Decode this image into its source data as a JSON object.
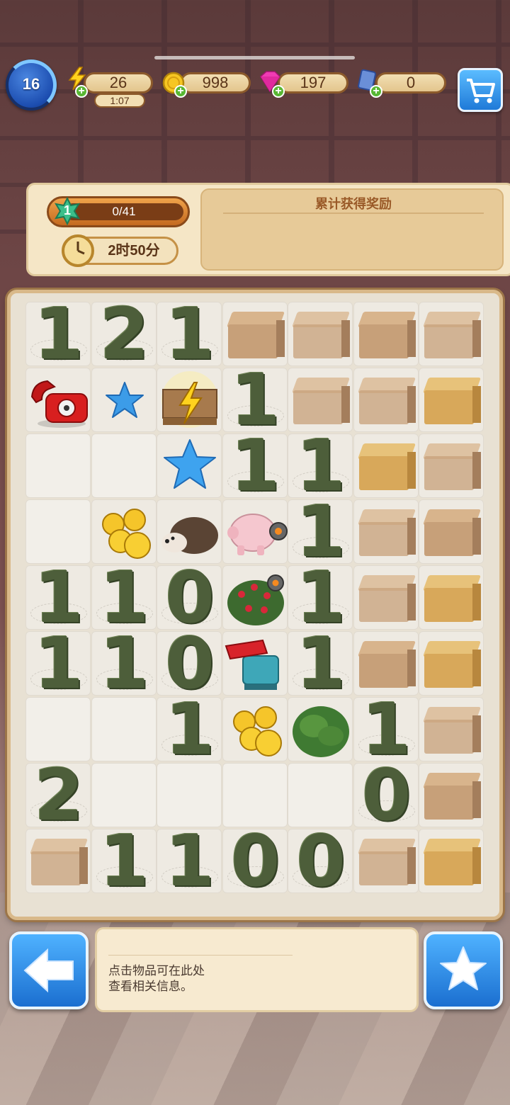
{
  "status_bar": {
    "level": "16",
    "energy": {
      "value": "26",
      "timer": "1:07",
      "icon": "lightning-icon"
    },
    "coins": {
      "value": "998",
      "icon": "coin-icon"
    },
    "gems": {
      "value": "197",
      "icon": "gem-icon"
    },
    "tickets": {
      "value": "0",
      "icon": "ticket-icon"
    },
    "cart_icon": "shopping-cart-icon"
  },
  "reward_panel": {
    "level_badge": "1",
    "progress_text": "0/41",
    "progress_fraction": 0.0,
    "time_left": "2时50分",
    "title": "累计获得奖励"
  },
  "board": {
    "rows": [
      [
        {
          "d": "1"
        },
        {
          "d": "2"
        },
        {
          "d": "1"
        },
        {
          "box": "plain"
        },
        {
          "box": "fog"
        },
        {
          "box": "plain"
        },
        {
          "box": "fog"
        }
      ],
      [
        {
          "item": "telephone"
        },
        {
          "item": "star-small"
        },
        {
          "item": "energy-pallet"
        },
        {
          "d": "1"
        },
        {
          "box": "fog"
        },
        {
          "box": "fog"
        },
        {
          "box": "gold"
        }
      ],
      [
        {
          "e": "light"
        },
        {
          "e": "light"
        },
        {
          "item": "star"
        },
        {
          "d": "1"
        },
        {
          "d": "1"
        },
        {
          "box": "gold"
        },
        {
          "box": "fog"
        }
      ],
      [
        {
          "e": "light"
        },
        {
          "item": "coins"
        },
        {
          "item": "hedgehog"
        },
        {
          "item": "piggy-bank"
        },
        {
          "d": "1"
        },
        {
          "box": "fog"
        },
        {
          "box": "plain"
        }
      ],
      [
        {
          "d": "1"
        },
        {
          "d": "1"
        },
        {
          "d": "0"
        },
        {
          "item": "rose-bush"
        },
        {
          "d": "1"
        },
        {
          "box": "fog"
        },
        {
          "box": "gold"
        }
      ],
      [
        {
          "d": "1"
        },
        {
          "d": "1"
        },
        {
          "d": "0"
        },
        {
          "item": "grinder"
        },
        {
          "d": "1"
        },
        {
          "box": "plain"
        },
        {
          "box": "gold"
        }
      ],
      [
        {
          "e": "light"
        },
        {
          "e": "light"
        },
        {
          "d": "1"
        },
        {
          "item": "coins"
        },
        {
          "item": "bush"
        },
        {
          "d": "1"
        },
        {
          "box": "fog"
        }
      ],
      [
        {
          "d": "2"
        },
        {
          "e": "light"
        },
        {
          "e": "light"
        },
        {
          "e": "light"
        },
        {
          "e": "light"
        },
        {
          "d": "0"
        },
        {
          "box": "plain"
        }
      ],
      [
        {
          "box": "fog"
        },
        {
          "d": "1"
        },
        {
          "d": "1"
        },
        {
          "d": "0"
        },
        {
          "d": "0"
        },
        {
          "box": "fog"
        },
        {
          "box": "gold"
        }
      ]
    ]
  },
  "bottom": {
    "back_icon": "arrow-left-icon",
    "info_line1": "点击物品可在此处",
    "info_line2": "查看相关信息。",
    "star_icon": "star-icon"
  }
}
